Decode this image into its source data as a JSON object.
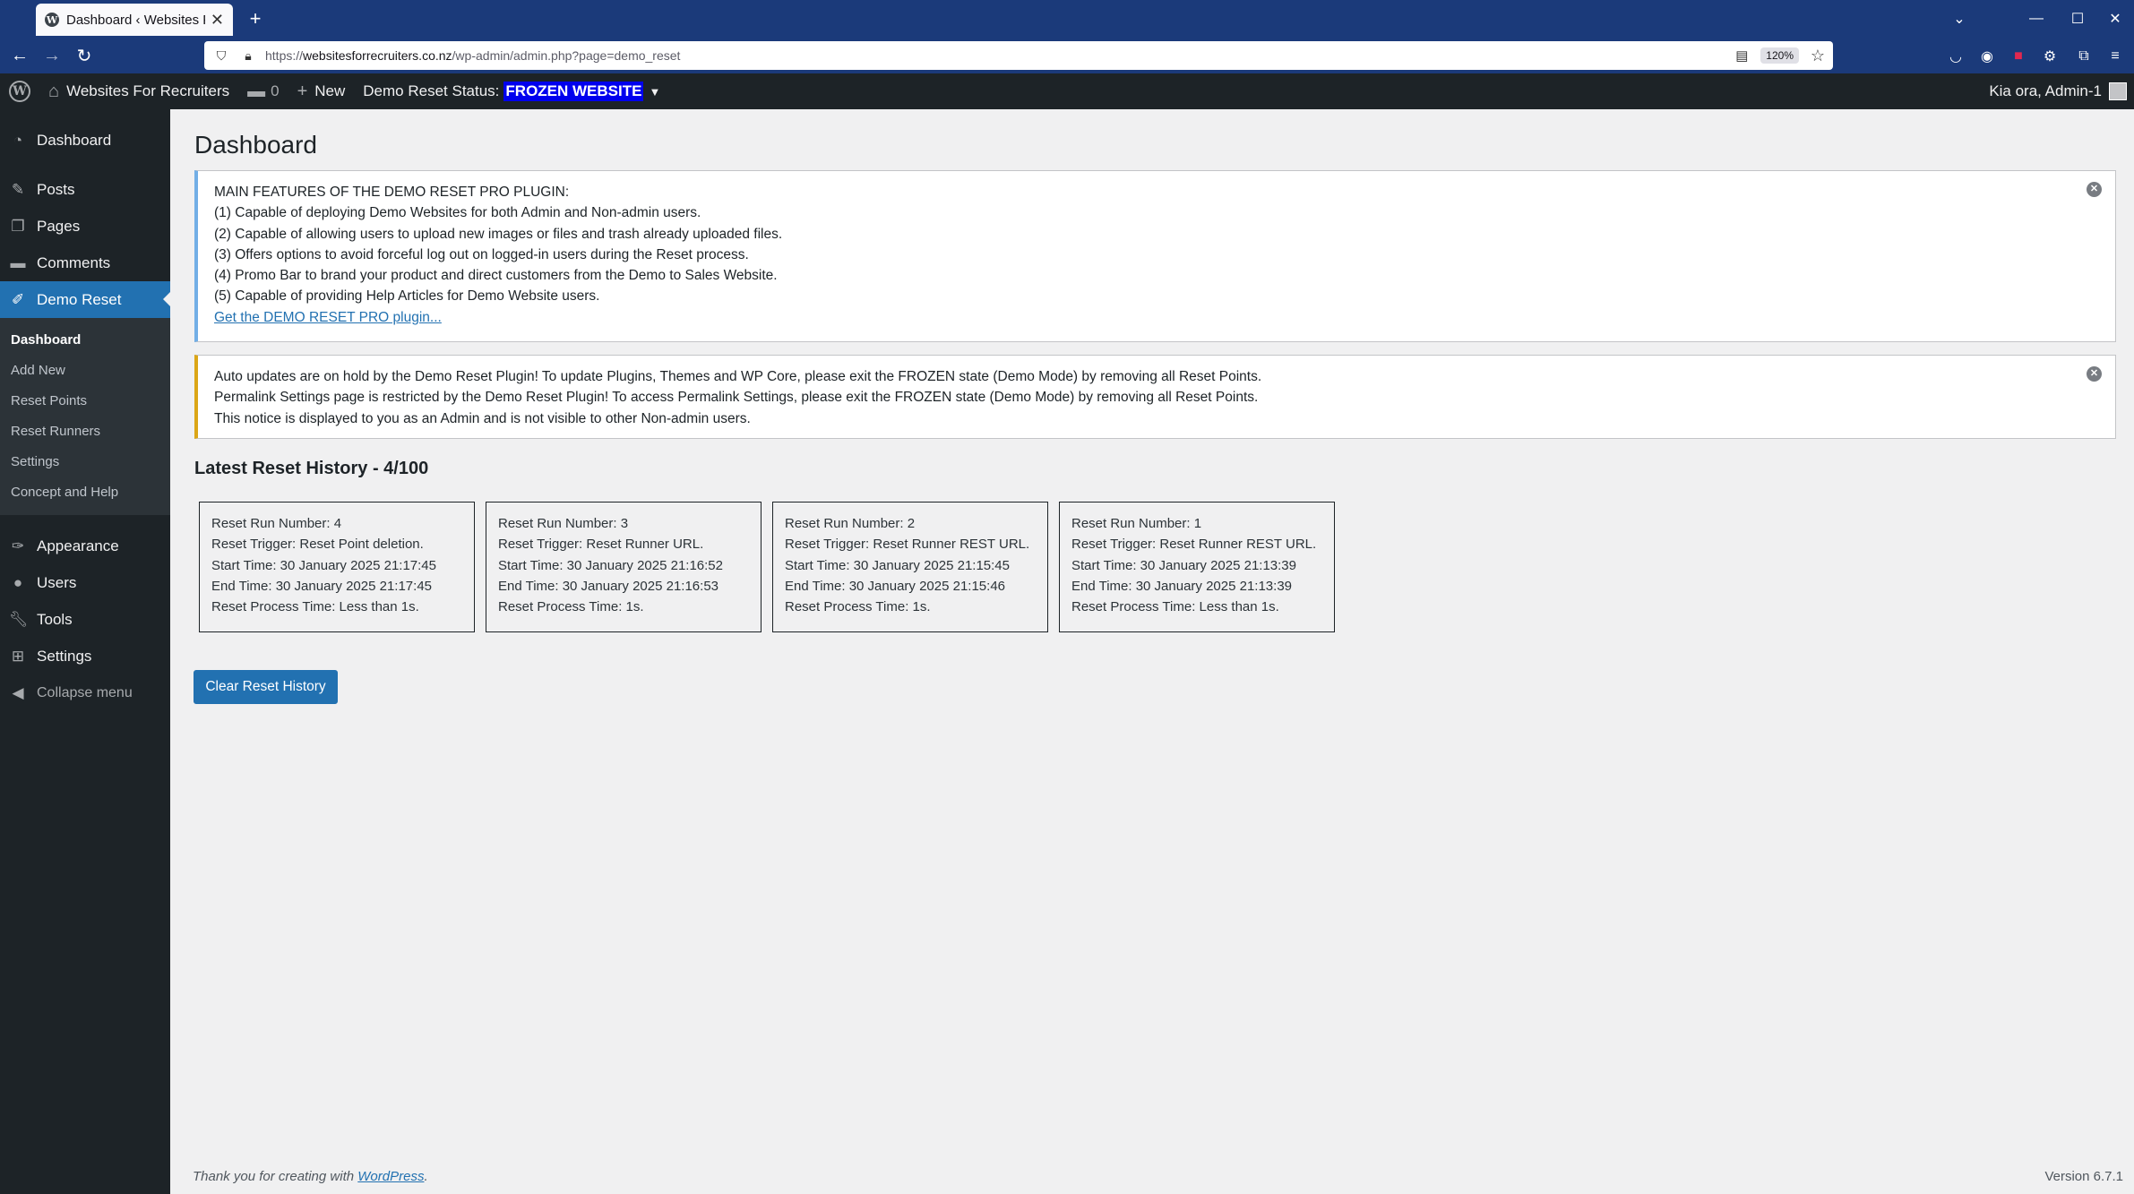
{
  "browser": {
    "tab_title": "Dashboard ‹ Websites For Recruiters",
    "tab_close": "✕",
    "new_tab": "+",
    "url_prefix": "https://",
    "url_domain": "websitesforrecruiters.co.nz",
    "url_path": "/wp-admin/admin.php?page=demo_reset",
    "zoom": "120%",
    "icons": [
      "back-icon",
      "forward-icon",
      "reload-icon",
      "shield-icon",
      "lock-icon",
      "reader-icon",
      "star-icon",
      "pocket-icon",
      "account-icon",
      "extension-red-icon",
      "gear-icon",
      "puzzle-icon",
      "menu-icon"
    ]
  },
  "adminbar": {
    "site_name": "Websites For Recruiters",
    "comments_count": "0",
    "new_label": "New",
    "status_label": "Demo Reset Status:",
    "status_value": "FROZEN WEBSITE",
    "howdy": "Kia ora, Admin-1"
  },
  "sidebar": {
    "items": [
      {
        "label": "Dashboard",
        "icon": "dashboard-icon"
      },
      {
        "label": "Posts",
        "icon": "pin-icon"
      },
      {
        "label": "Pages",
        "icon": "pages-icon"
      },
      {
        "label": "Comments",
        "icon": "comments-icon"
      },
      {
        "label": "Demo Reset",
        "icon": "demo-reset-icon"
      },
      {
        "label": "Appearance",
        "icon": "brush-icon"
      },
      {
        "label": "Users",
        "icon": "users-icon"
      },
      {
        "label": "Tools",
        "icon": "wrench-icon"
      },
      {
        "label": "Settings",
        "icon": "settings-icon"
      }
    ],
    "submenu": [
      "Dashboard",
      "Add New",
      "Reset Points",
      "Reset Runners",
      "Settings",
      "Concept and Help"
    ],
    "collapse": "Collapse menu"
  },
  "main": {
    "title": "Dashboard",
    "info_notice": {
      "heading": "MAIN FEATURES OF THE DEMO RESET PRO PLUGIN:",
      "lines": [
        "(1) Capable of deploying Demo Websites for both Admin and Non-admin users.",
        "(2) Capable of allowing users to upload new images or files and trash already uploaded files.",
        "(3) Offers options to avoid forceful log out on logged-in users during the Reset process.",
        "(4) Promo Bar to brand your product and direct customers from the Demo to Sales Website.",
        "(5) Capable of providing Help Articles for Demo Website users."
      ],
      "link": "Get the DEMO RESET PRO plugin..."
    },
    "warning_notice": {
      "lines": [
        "Auto updates are on hold by the Demo Reset Plugin! To update Plugins, Themes and WP Core, please exit the FROZEN state (Demo Mode) by removing all Reset Points.",
        "Permalink Settings page is restricted by the Demo Reset Plugin! To access Permalink Settings, please exit the FROZEN state (Demo Mode) by removing all Reset Points.",
        "This notice is displayed to you as an Admin and is not visible to other Non-admin users."
      ]
    },
    "history_title": "Latest Reset History - 4/100",
    "history": [
      {
        "run": "Reset Run Number: 4",
        "trigger": "Reset Trigger: Reset Point deletion.",
        "start": "Start Time: 30 January 2025 21:17:45",
        "end": "End Time: 30 January 2025 21:17:45",
        "process": "Reset Process Time: Less than 1s."
      },
      {
        "run": "Reset Run Number: 3",
        "trigger": "Reset Trigger: Reset Runner URL.",
        "start": "Start Time: 30 January 2025 21:16:52",
        "end": "End Time: 30 January 2025 21:16:53",
        "process": "Reset Process Time: 1s."
      },
      {
        "run": "Reset Run Number: 2",
        "trigger": "Reset Trigger: Reset Runner REST URL.",
        "start": "Start Time: 30 January 2025 21:15:45",
        "end": "End Time: 30 January 2025 21:15:46",
        "process": "Reset Process Time: 1s."
      },
      {
        "run": "Reset Run Number: 1",
        "trigger": "Reset Trigger: Reset Runner REST URL.",
        "start": "Start Time: 30 January 2025 21:13:39",
        "end": "End Time: 30 January 2025 21:13:39",
        "process": "Reset Process Time: Less than 1s."
      }
    ],
    "clear_button": "Clear Reset History"
  },
  "footer": {
    "thanks_prefix": "Thank you for creating with ",
    "thanks_link": "WordPress",
    "thanks_suffix": ".",
    "version": "Version 6.7.1"
  },
  "colors": {
    "accent": "#2271b1",
    "adminbar": "#1d2327",
    "browser_frame": "#1b3a7a",
    "frozen_highlight": "#0000ee",
    "info_border": "#72aee6",
    "warning_border": "#dba617"
  }
}
